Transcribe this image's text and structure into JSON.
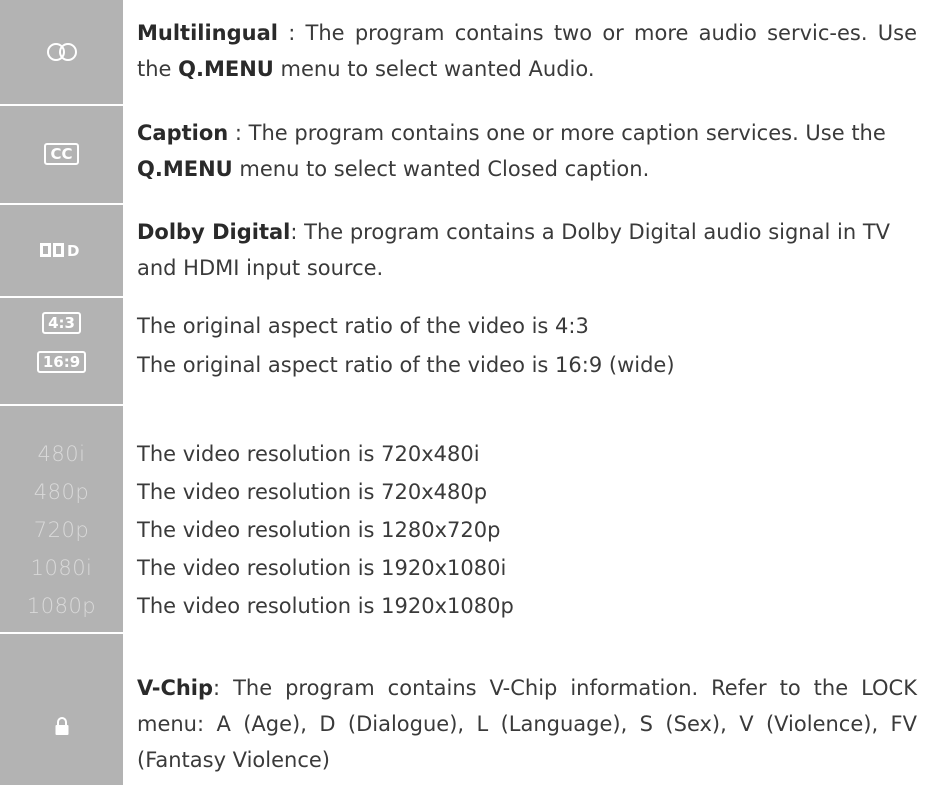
{
  "items": {
    "multilingual": {
      "icon": "multilingual-icon",
      "term": "Multilingual",
      "text_a": " : The program contains two or more audio servic-es. Use the ",
      "menu": "Q.MENU",
      "text_b": " menu to select wanted Audio."
    },
    "caption": {
      "icon_label": "CC",
      "term": "Caption",
      "text_a": " : The program contains one or more caption services. Use the ",
      "menu": "Q.MENU",
      "text_b": " menu to select wanted Closed caption."
    },
    "dolby": {
      "icon": "dolby-digital-icon",
      "icon_label": "D",
      "term": "Dolby Digital",
      "text": ": The program contains a Dolby Digital audio signal in TV and HDMI input source."
    },
    "aspect": [
      {
        "label": "4:3",
        "text": "The original aspect ratio of the video is 4:3"
      },
      {
        "label": "16:9",
        "text": "The original aspect ratio of the video is 16:9 (wide)"
      }
    ],
    "resolutions": [
      {
        "label": "480i",
        "text": "The video resolution is 720x480i"
      },
      {
        "label": "480p",
        "text": "The video resolution is 720x480p"
      },
      {
        "label": "720p",
        "text": "The video resolution is 1280x720p"
      },
      {
        "label": "1080i",
        "text": "The video resolution is 1920x1080i"
      },
      {
        "label": "1080p",
        "text": "The video resolution is 1920x1080p"
      }
    ],
    "vchip": {
      "icon": "lock-icon",
      "term": "V-Chip",
      "text": ": The program contains V-Chip information. Refer to the LOCK menu: A (Age), D (Dialogue), L (Language), S (Sex), V (Violence), FV (Fantasy Violence)"
    }
  }
}
